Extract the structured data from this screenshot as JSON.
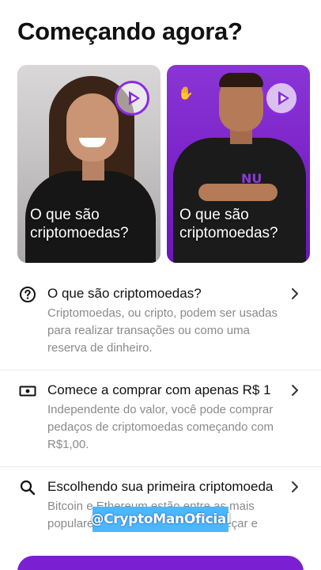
{
  "header": {
    "title": "Começando agora?"
  },
  "videos": [
    {
      "caption": "O que são criptomoedas?"
    },
    {
      "caption": "O que são criptomoedas?",
      "badge": "NU"
    }
  ],
  "items": [
    {
      "icon": "question-circle-icon",
      "title": "O que são criptomoedas?",
      "description": "Criptomoedas, ou cripto, podem ser usadas para realizar transações ou como uma reserva de dinheiro."
    },
    {
      "icon": "banknote-icon",
      "title": "Comece a comprar com apenas R$ 1",
      "description": "Independente do valor, você pode comprar pedaços de criptomoedas começando com R$1,00."
    },
    {
      "icon": "search-icon",
      "title": "Escolhendo sua primeira criptomoeda",
      "description": "Bitcoin e Ethereum estão entre as mais populares e mais fáceis para começar e"
    }
  ],
  "overlay": {
    "watermark": "@CryptoManOficial"
  },
  "colors": {
    "accent": "#8a2be2",
    "watermark_bg": "#4cb7ff"
  }
}
